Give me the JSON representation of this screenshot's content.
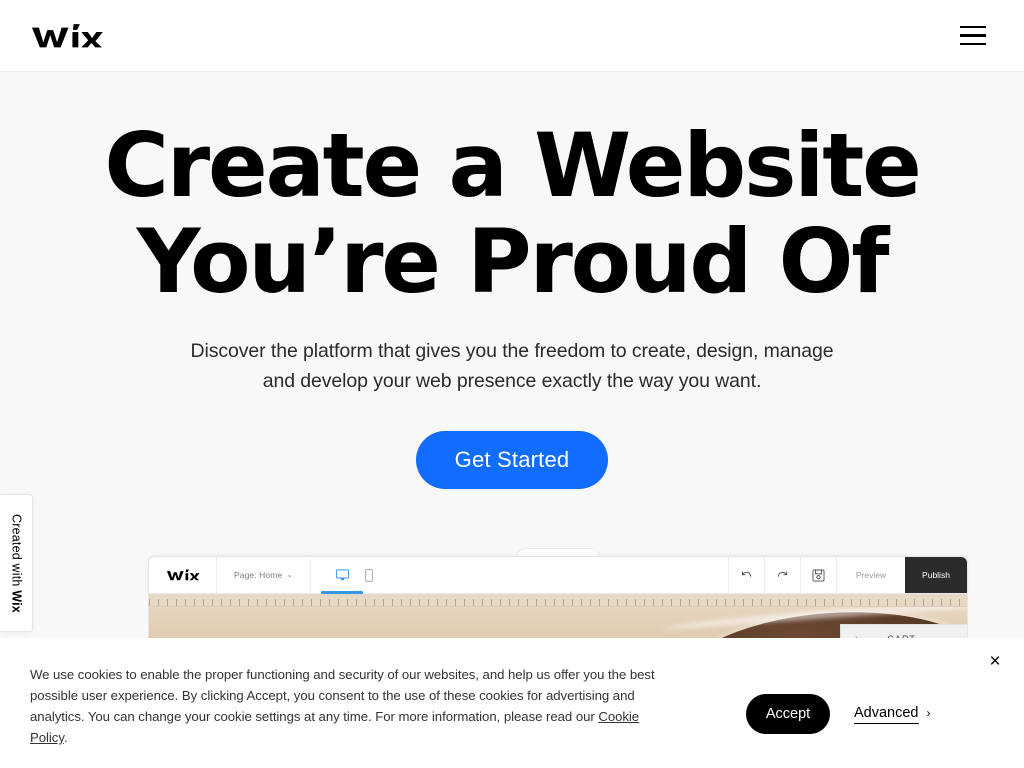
{
  "header": {
    "logo_alt": "Wix",
    "menu_label": "Menu"
  },
  "hero": {
    "title_line1": "Create a Website",
    "title_line2": "You’re Proud Of",
    "subtitle": "Discover the platform that gives you the freedom to create, design, manage and develop your web presence exactly the way you want.",
    "cta_label": "Get Started",
    "cta_color": "#116dff"
  },
  "created_badge": {
    "prefix": "Created with ",
    "brand": "Wix"
  },
  "editor": {
    "logo_alt": "Wix",
    "page_label": "Page: Home",
    "page_chevron": "⌄",
    "device_desktop": "desktop-view",
    "device_mobile": "mobile-view",
    "undo_label": "Undo",
    "redo_label": "Redo",
    "save_label": "Save",
    "preview_label": "Preview",
    "publish_label": "Publish",
    "cart_label": "CART",
    "cart_chevron": "›"
  },
  "cookie": {
    "body": "We use cookies to enable the proper functioning and security of our websites, and help us offer you the best possible user experience. By clicking Accept, you consent to the use of these cookies for advertising and analytics. You can change your cookie settings at any time. For more information, please read our ",
    "link_label": "Cookie Policy",
    "body_tail": ".",
    "accept_label": "Accept",
    "advanced_label": "Advanced",
    "advanced_chevron": "›",
    "close_label": "×"
  }
}
